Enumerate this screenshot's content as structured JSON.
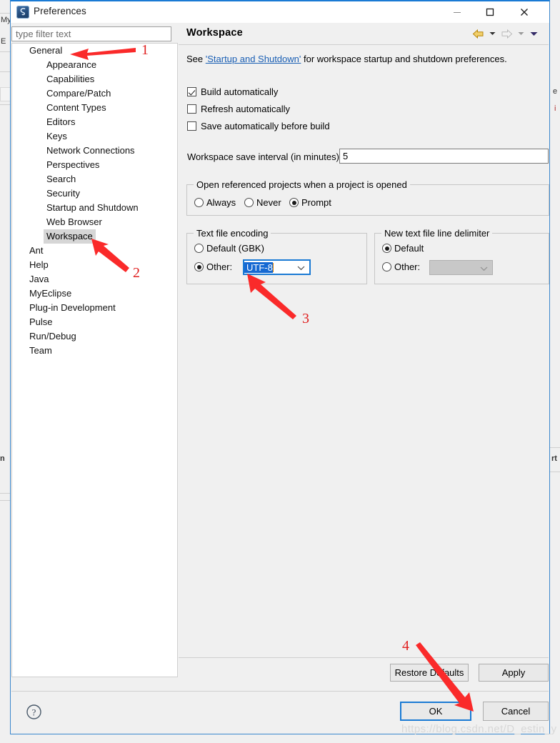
{
  "window": {
    "title": "Preferences",
    "app_icon": "myeclipse-icon",
    "controls": {
      "minimize": "minimize-icon",
      "maximize": "maximize-icon",
      "close": "close-icon"
    }
  },
  "filter": {
    "placeholder": "type filter text",
    "value": ""
  },
  "tree": {
    "items": [
      {
        "label": "General",
        "level": 0,
        "selected": false
      },
      {
        "label": "Appearance",
        "level": 1,
        "selected": false
      },
      {
        "label": "Capabilities",
        "level": 1,
        "selected": false
      },
      {
        "label": "Compare/Patch",
        "level": 1,
        "selected": false
      },
      {
        "label": "Content Types",
        "level": 1,
        "selected": false
      },
      {
        "label": "Editors",
        "level": 1,
        "selected": false
      },
      {
        "label": "Keys",
        "level": 1,
        "selected": false
      },
      {
        "label": "Network Connections",
        "level": 1,
        "selected": false
      },
      {
        "label": "Perspectives",
        "level": 1,
        "selected": false
      },
      {
        "label": "Search",
        "level": 1,
        "selected": false
      },
      {
        "label": "Security",
        "level": 1,
        "selected": false
      },
      {
        "label": "Startup and Shutdown",
        "level": 1,
        "selected": false
      },
      {
        "label": "Web Browser",
        "level": 1,
        "selected": false
      },
      {
        "label": "Workspace",
        "level": 1,
        "selected": true
      },
      {
        "label": "Ant",
        "level": 0,
        "selected": false
      },
      {
        "label": "Help",
        "level": 0,
        "selected": false
      },
      {
        "label": "Java",
        "level": 0,
        "selected": false
      },
      {
        "label": "MyEclipse",
        "level": 0,
        "selected": false
      },
      {
        "label": "Plug-in Development",
        "level": 0,
        "selected": false
      },
      {
        "label": "Pulse",
        "level": 0,
        "selected": false
      },
      {
        "label": "Run/Debug",
        "level": 0,
        "selected": false
      },
      {
        "label": "Team",
        "level": 0,
        "selected": false
      }
    ]
  },
  "panel": {
    "title": "Workspace",
    "nav": {
      "back": "back-arrow-icon",
      "back_menu": "chevron-down-icon",
      "forward": "forward-arrow-icon",
      "forward_menu": "chevron-down-icon",
      "view_menu": "chevron-down-icon"
    },
    "description": {
      "prefix": "See ",
      "link": "'Startup and Shutdown'",
      "suffix": " for workspace startup and shutdown preferences."
    },
    "checkboxes": [
      {
        "label": "Build automatically",
        "checked": true
      },
      {
        "label": "Refresh automatically",
        "checked": false
      },
      {
        "label": "Save automatically before build",
        "checked": false
      }
    ],
    "save_interval": {
      "label": "Workspace save interval (in minutes):",
      "value": "5"
    },
    "open_referenced": {
      "title": "Open referenced projects when a project is opened",
      "options": [
        {
          "label": "Always",
          "selected": false
        },
        {
          "label": "Never",
          "selected": false
        },
        {
          "label": "Prompt",
          "selected": true
        }
      ]
    },
    "text_file_encoding": {
      "title": "Text file encoding",
      "default_option": {
        "label": "Default (GBK)",
        "selected": false
      },
      "other_option": {
        "label": "Other:",
        "selected": true
      },
      "combo_value": "UTF-8",
      "combo_focused": true,
      "combo_text_selected": true
    },
    "line_delimiter": {
      "title": "New text file line delimiter",
      "default_option": {
        "label": "Default",
        "selected": true
      },
      "other_option": {
        "label": "Other:",
        "selected": false
      },
      "combo_value": "",
      "combo_disabled": true
    },
    "buttons": {
      "restore_defaults": "Restore Defaults",
      "apply": "Apply"
    }
  },
  "footer": {
    "help": "help-icon",
    "ok": "OK",
    "cancel": "Cancel"
  },
  "annotations": {
    "numbers": [
      "1",
      "2",
      "3",
      "4"
    ],
    "color": "#e02020"
  },
  "watermark": "https://blog.csdn.net/D_estin_y",
  "background_ide": {
    "left_labels": [
      "My",
      "E",
      "n"
    ],
    "right_labels": [
      "e",
      "i",
      "rt"
    ]
  }
}
